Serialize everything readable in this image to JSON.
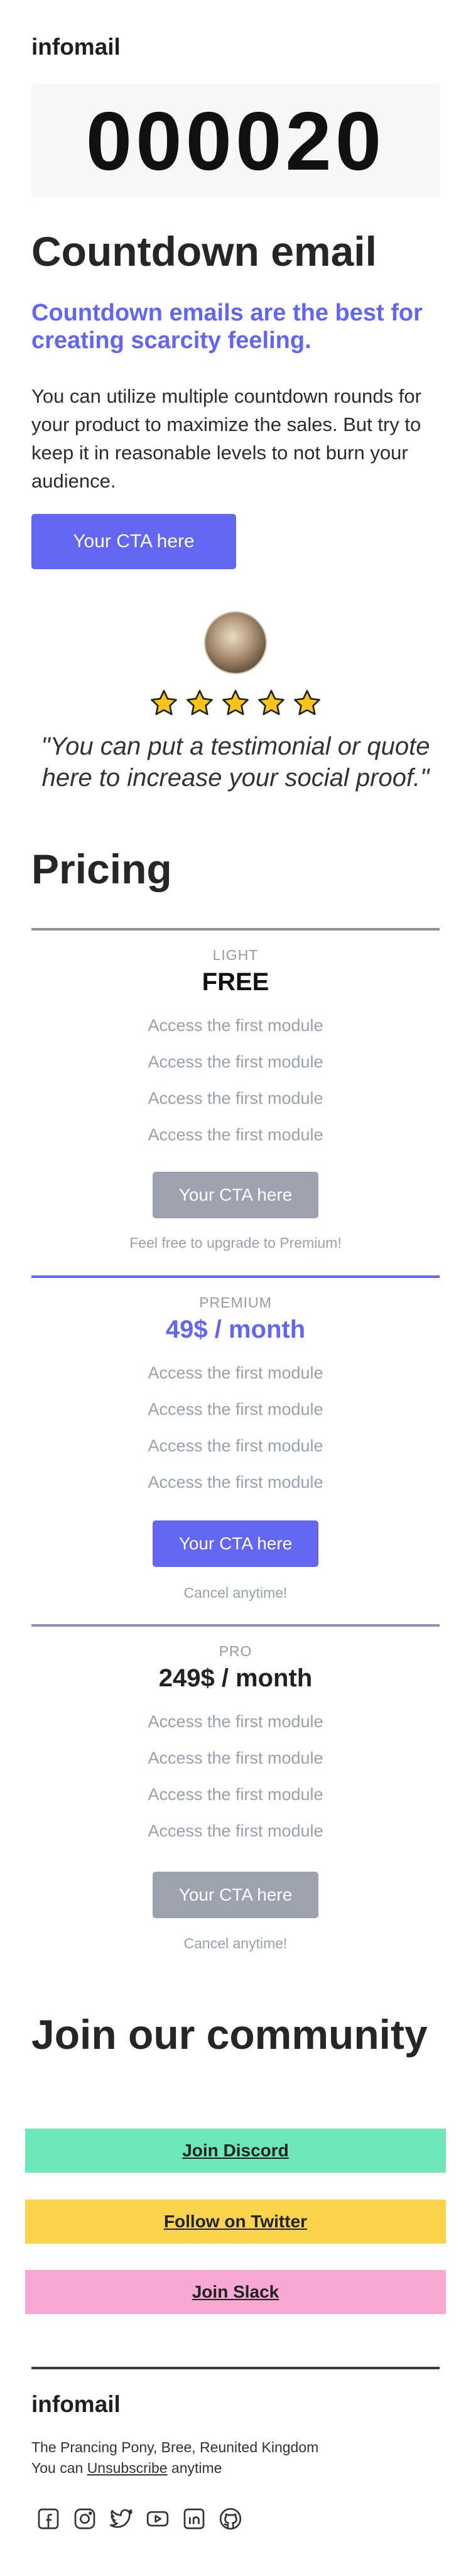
{
  "header": {
    "brand": "infomail"
  },
  "countdown": {
    "value": "000020"
  },
  "hero": {
    "title": "Countdown email",
    "subtitle": "Countdown emails are the best for creating scarcity feeling.",
    "body": "You can utilize multiple countdown rounds for your product to maximize the sales. But try to keep it in reasonable levels to not burn your audience.",
    "cta_label": "Your CTA here"
  },
  "testimonial": {
    "rating": 5,
    "quote": "\"You can put a testimonial or quote here to increase your social proof.\""
  },
  "pricing": {
    "title": "Pricing",
    "plans": [
      {
        "tier": "LIGHT",
        "price": "FREE",
        "features": [
          "Access the first module",
          "Access the first module",
          "Access the first module",
          "Access the first module"
        ],
        "cta_label": "Your CTA here",
        "note": "Feel free to upgrade to Premium!",
        "accent": "#9ca3af",
        "line_color": "#8b8f99",
        "price_color": "#111111"
      },
      {
        "tier": "PREMIUM",
        "price": "49$ / month",
        "features": [
          "Access the first module",
          "Access the first module",
          "Access the first module",
          "Access the first module"
        ],
        "cta_label": "Your CTA here",
        "note": "Cancel anytime!",
        "accent": "#6366f1",
        "line_color": "#6366f1",
        "price_color": "#6366f1"
      },
      {
        "tier": "PRO",
        "price": "249$ / month",
        "features": [
          "Access the first module",
          "Access the first module",
          "Access the first module",
          "Access the first module"
        ],
        "cta_label": "Your CTA here",
        "note": "Cancel anytime!",
        "accent": "#9ca3af",
        "line_color": "#8d93b8",
        "price_color": "#222222"
      }
    ]
  },
  "community": {
    "title": "Join our community",
    "links": [
      {
        "label": "Join Discord",
        "color": "#6ee7b7"
      },
      {
        "label": "Follow on Twitter",
        "color": "#fcd34d"
      },
      {
        "label": "Join Slack",
        "color": "#f9a8d4"
      }
    ]
  },
  "footer": {
    "brand": "infomail",
    "address": "The Prancing Pony, Bree, Reunited Kingdom",
    "unsub_prefix": "You can ",
    "unsub_link": "Unsubscribe",
    "unsub_suffix": " anytime",
    "socials": [
      "facebook-icon",
      "instagram-icon",
      "twitter-icon",
      "youtube-icon",
      "linkedin-icon",
      "github-icon"
    ]
  },
  "colors": {
    "accent": "#6366f1",
    "text": "#262626",
    "muted": "#9aa0ab"
  }
}
